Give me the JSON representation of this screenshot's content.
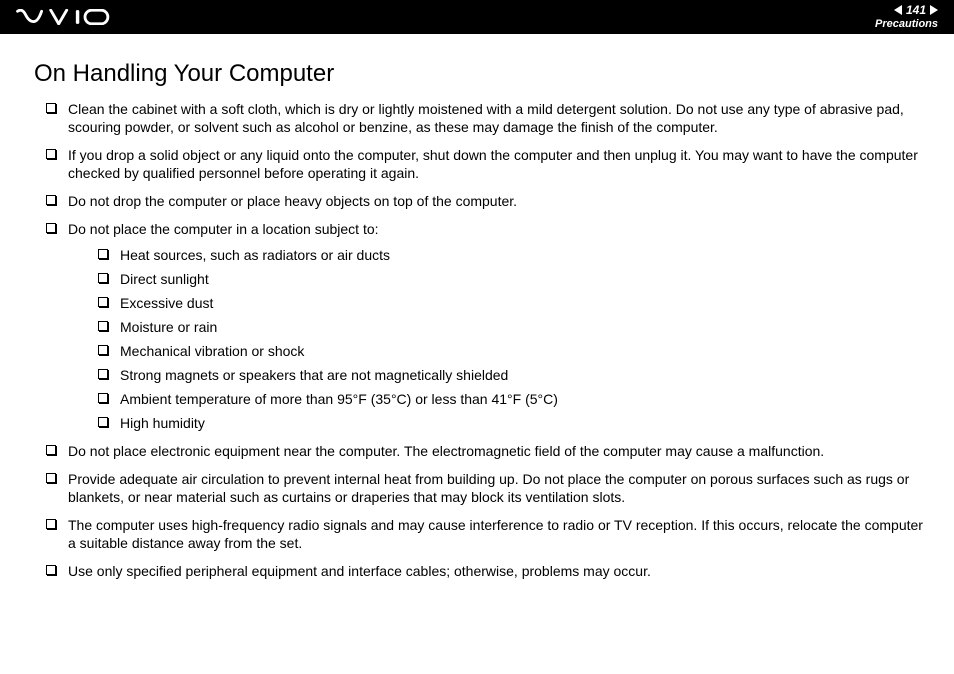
{
  "header": {
    "page_number": "141",
    "section": "Precautions"
  },
  "title": "On Handling Your Computer",
  "items": [
    "Clean the cabinet with a soft cloth, which is dry or lightly moistened with a mild detergent solution. Do not use any type of abrasive pad, scouring powder, or solvent such as alcohol or benzine, as these may damage the finish of the computer.",
    "If you drop a solid object or any liquid onto the computer, shut down the computer and then unplug it. You may want to have the computer checked by qualified personnel before operating it again.",
    "Do not drop the computer or place heavy objects on top of the computer.",
    "Do not place the computer in a location subject to:",
    "Do not place electronic equipment near the computer. The electromagnetic field of the computer may cause a malfunction.",
    "Provide adequate air circulation to prevent internal heat from building up. Do not place the computer on porous surfaces such as rugs or blankets, or near material such as curtains or draperies that may block its ventilation slots.",
    "The computer uses high-frequency radio signals and may cause interference to radio or TV reception. If this occurs, relocate the computer a suitable distance away from the set.",
    "Use only specified peripheral equipment and interface cables; otherwise, problems may occur."
  ],
  "sub_items": [
    "Heat sources, such as radiators or air ducts",
    "Direct sunlight",
    "Excessive dust",
    "Moisture or rain",
    "Mechanical vibration or shock",
    "Strong magnets or speakers that are not magnetically shielded",
    "Ambient temperature of more than 95°F (35°C) or less than 41°F (5°C)",
    "High humidity"
  ]
}
